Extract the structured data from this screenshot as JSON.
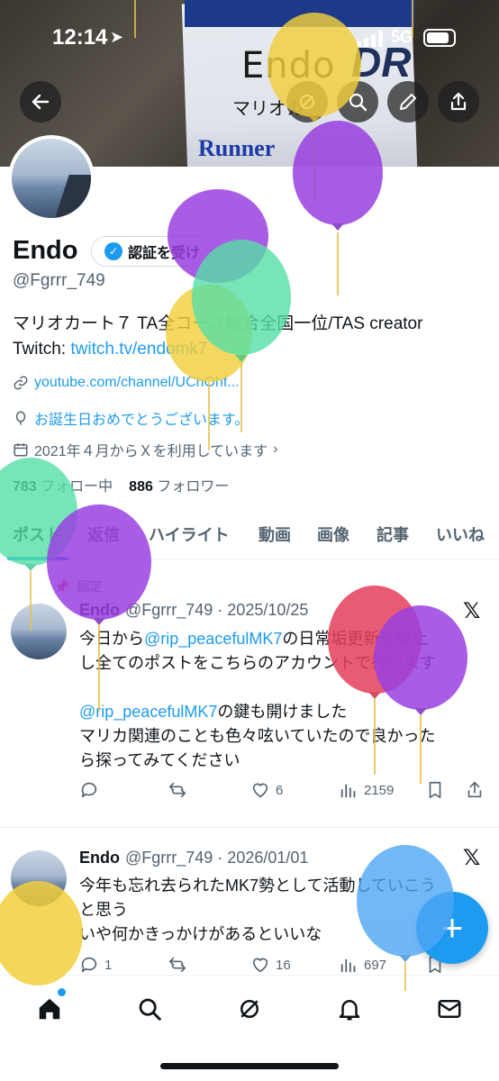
{
  "status_bar": {
    "time": "12:14",
    "network": "5G"
  },
  "banner": {
    "badge_name": "Endo",
    "badge_sub": "マリオカ",
    "badge_run": "Runner",
    "badge_dr": "DR"
  },
  "profile": {
    "name": "Endo",
    "verify_label": "認証を受け",
    "handle": "@Fgrrr_749",
    "bio_line1": "マリオカート７ TA全コース総合全国一位/TAS creator",
    "bio_twitch_prefix": "Twitch: ",
    "bio_twitch_link": "twitch.tv/endomk7",
    "website": "youtube.com/channel/UChOhf...",
    "birthday": "お誕生日おめでとうございます。",
    "joined": "2021年４月からＸを利用しています",
    "following_count": "783",
    "following_label": "フォロー中",
    "followers_count": "886",
    "followers_label": "フォロワー"
  },
  "tabs": [
    "ポスト",
    "返信",
    "ハイライト",
    "動画",
    "画像",
    "記事",
    "いいね"
  ],
  "posts": [
    {
      "pinned_label": "固定",
      "name": "Endo",
      "handle_date": "@Fgrrr_749 · 2025/10/25",
      "line1_pre": "今日から",
      "line1_mention": "@rip_peacefulMK7",
      "line1_post": "の日常垢更新を停止",
      "line2": "し全てのポストをこちらのアカウントで行います",
      "line3_mention": "@rip_peacefulMK7",
      "line3_post": "の鍵も開けました",
      "line4": "マリカ関連のことも色々呟いていたので良かった",
      "line5": "ら探ってみてください",
      "replies": "",
      "reposts": "",
      "likes": "6",
      "views": "2159"
    },
    {
      "name": "Endo",
      "handle_date": "@Fgrrr_749 · 2026/01/01",
      "line1": "今年も忘れ去られたMK7勢として活動していこう",
      "line2": "と思う",
      "line3": "いや何かきっかけがあるといいな",
      "replies": "1",
      "reposts": "",
      "likes": "16",
      "views": "697"
    }
  ],
  "fab_label": "+",
  "colors": {
    "accent": "#1d9bf0",
    "text": "#0f1419",
    "muted": "#536471",
    "balloon_yellow": "#f2cf3c",
    "balloon_purple": "#9a3fe0",
    "balloon_green": "#55dfa6",
    "balloon_red": "#e4405a",
    "balloon_blue": "#4ea6f5"
  }
}
